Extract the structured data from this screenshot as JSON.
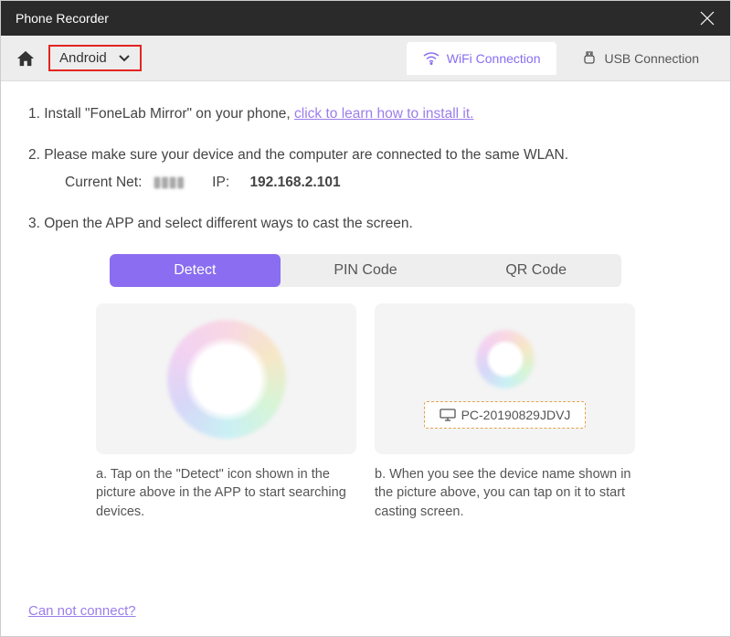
{
  "titlebar": {
    "title": "Phone Recorder"
  },
  "toolbar": {
    "platform": "Android",
    "tabs": {
      "wifi": "WiFi Connection",
      "usb": "USB Connection"
    }
  },
  "steps": {
    "s1_prefix": "1. Install \"FoneLab Mirror\" on your phone, ",
    "s1_link": "click to learn how to install it.",
    "s2": "2. Please make sure your device and the computer are connected to the same WLAN.",
    "net_label": "Current Net:",
    "net_ssid": "▮▮▮▮",
    "ip_label": "IP:",
    "ip_value": "192.168.2.101",
    "s3": "3. Open the APP and select different ways to cast the screen."
  },
  "methods": {
    "detect": "Detect",
    "pin": "PIN Code",
    "qr": "QR Code"
  },
  "device_name": "PC-20190829JDVJ",
  "captions": {
    "a": "a. Tap on the \"Detect\" icon shown in the picture above in the APP to start searching devices.",
    "b": "b. When you see the device name shown in the picture above, you can tap on it to start casting screen."
  },
  "footer": {
    "help": "Can not connect?"
  }
}
